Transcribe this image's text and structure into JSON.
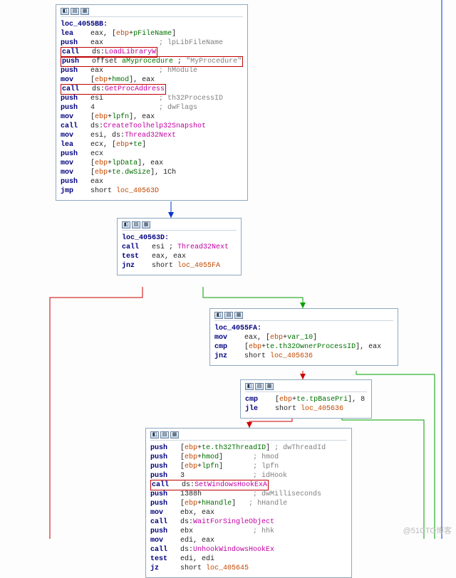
{
  "watermark": "@51CTO博客",
  "nodes": {
    "n1": {
      "label": "loc_4055BB:",
      "lines": [
        {
          "mn": "lea",
          "args": [
            {
              "t": "eax, ["
            },
            {
              "t": "ebp",
              "c": "addr"
            },
            {
              "t": "+"
            },
            {
              "t": "pFileName",
              "c": "op"
            },
            {
              "t": "]"
            }
          ]
        },
        {
          "mn": "push",
          "args": [
            {
              "t": "eax             "
            }
          ],
          "cmt": "; lpLibFileName"
        },
        {
          "hilite": true,
          "mn": "call",
          "args": [
            {
              "t": "ds:"
            },
            {
              "t": "LoadLibraryW",
              "c": "api"
            }
          ]
        },
        {
          "hilite": true,
          "mn": "push",
          "args": [
            {
              "t": "offset "
            },
            {
              "t": "aMyprocedure",
              "c": "op"
            },
            {
              "t": " ; "
            },
            {
              "t": "\"MyProcedure\"",
              "c": "cmt"
            }
          ]
        },
        {
          "mn": "push",
          "args": [
            {
              "t": "eax             "
            }
          ],
          "cmt": "; hModule"
        },
        {
          "mn": "mov",
          "args": [
            {
              "t": "["
            },
            {
              "t": "ebp",
              "c": "addr"
            },
            {
              "t": "+"
            },
            {
              "t": "hmod",
              "c": "op"
            },
            {
              "t": "], eax"
            }
          ]
        },
        {
          "hilite": true,
          "mn": "call",
          "args": [
            {
              "t": "ds:"
            },
            {
              "t": "GetProcAddress",
              "c": "api"
            }
          ]
        },
        {
          "mn": "push",
          "args": [
            {
              "t": "esi             "
            }
          ],
          "cmt": "; th32ProcessID"
        },
        {
          "mn": "push",
          "args": [
            {
              "t": "4               "
            }
          ],
          "cmt": "; dwFlags"
        },
        {
          "mn": "mov",
          "args": [
            {
              "t": "["
            },
            {
              "t": "ebp",
              "c": "addr"
            },
            {
              "t": "+"
            },
            {
              "t": "lpfn",
              "c": "op"
            },
            {
              "t": "], eax"
            }
          ]
        },
        {
          "mn": "call",
          "args": [
            {
              "t": "ds:"
            },
            {
              "t": "CreateToolhelp32Snapshot",
              "c": "api"
            }
          ]
        },
        {
          "mn": "mov",
          "args": [
            {
              "t": "esi, ds:"
            },
            {
              "t": "Thread32Next",
              "c": "api"
            }
          ]
        },
        {
          "mn": "lea",
          "args": [
            {
              "t": "ecx, ["
            },
            {
              "t": "ebp",
              "c": "addr"
            },
            {
              "t": "+"
            },
            {
              "t": "te",
              "c": "op"
            },
            {
              "t": "]"
            }
          ]
        },
        {
          "mn": "push",
          "args": [
            {
              "t": "ecx"
            }
          ]
        },
        {
          "mn": "mov",
          "args": [
            {
              "t": "["
            },
            {
              "t": "ebp",
              "c": "addr"
            },
            {
              "t": "+"
            },
            {
              "t": "lpData",
              "c": "op"
            },
            {
              "t": "], eax"
            }
          ]
        },
        {
          "mn": "mov",
          "args": [
            {
              "t": "["
            },
            {
              "t": "ebp",
              "c": "addr"
            },
            {
              "t": "+"
            },
            {
              "t": "te.dwSize",
              "c": "op"
            },
            {
              "t": "], 1Ch"
            }
          ]
        },
        {
          "mn": "push",
          "args": [
            {
              "t": "eax"
            }
          ]
        },
        {
          "mn": "jmp",
          "args": [
            {
              "t": "short "
            },
            {
              "t": "loc_40563D",
              "c": "addr"
            }
          ]
        }
      ]
    },
    "n2": {
      "label": "loc_40563D:",
      "lines": [
        {
          "mn": "call",
          "args": [
            {
              "t": "esi ; "
            },
            {
              "t": "Thread32Next",
              "c": "api"
            }
          ]
        },
        {
          "mn": "test",
          "args": [
            {
              "t": "eax, eax"
            }
          ]
        },
        {
          "mn": "jnz",
          "args": [
            {
              "t": "short "
            },
            {
              "t": "loc_4055FA",
              "c": "addr"
            }
          ]
        }
      ]
    },
    "n3": {
      "label": "loc_4055FA:",
      "lines": [
        {
          "mn": "mov",
          "args": [
            {
              "t": "eax, ["
            },
            {
              "t": "ebp",
              "c": "addr"
            },
            {
              "t": "+"
            },
            {
              "t": "var_10",
              "c": "op"
            },
            {
              "t": "]"
            }
          ]
        },
        {
          "mn": "cmp",
          "args": [
            {
              "t": "["
            },
            {
              "t": "ebp",
              "c": "addr"
            },
            {
              "t": "+"
            },
            {
              "t": "te.th32OwnerProcessID",
              "c": "op"
            },
            {
              "t": "], eax"
            }
          ]
        },
        {
          "mn": "jnz",
          "args": [
            {
              "t": "short "
            },
            {
              "t": "loc_405636",
              "c": "addr"
            }
          ]
        }
      ]
    },
    "n4": {
      "label": "",
      "lines": [
        {
          "mn": "cmp",
          "args": [
            {
              "t": "["
            },
            {
              "t": "ebp",
              "c": "addr"
            },
            {
              "t": "+"
            },
            {
              "t": "te.tpBasePri",
              "c": "op"
            },
            {
              "t": "], 8"
            }
          ]
        },
        {
          "mn": "jle",
          "args": [
            {
              "t": "short "
            },
            {
              "t": "loc_405636",
              "c": "addr"
            }
          ]
        }
      ]
    },
    "n5": {
      "label": "",
      "lines": [
        {
          "mn": "push",
          "args": [
            {
              "t": "["
            },
            {
              "t": "ebp",
              "c": "addr"
            },
            {
              "t": "+"
            },
            {
              "t": "te.th32ThreadID",
              "c": "op"
            },
            {
              "t": "] "
            }
          ],
          "cmt": "; dwThreadId"
        },
        {
          "mn": "push",
          "args": [
            {
              "t": "["
            },
            {
              "t": "ebp",
              "c": "addr"
            },
            {
              "t": "+"
            },
            {
              "t": "hmod",
              "c": "op"
            },
            {
              "t": "]       "
            }
          ],
          "cmt": "; hmod"
        },
        {
          "mn": "push",
          "args": [
            {
              "t": "["
            },
            {
              "t": "ebp",
              "c": "addr"
            },
            {
              "t": "+"
            },
            {
              "t": "lpfn",
              "c": "op"
            },
            {
              "t": "]       "
            }
          ],
          "cmt": "; lpfn"
        },
        {
          "mn": "push",
          "args": [
            {
              "t": "3                "
            }
          ],
          "cmt": "; idHook"
        },
        {
          "hilite": true,
          "mn": "call",
          "args": [
            {
              "t": "ds:"
            },
            {
              "t": "SetWindowsHookExA",
              "c": "api"
            }
          ]
        },
        {
          "mn": "push",
          "args": [
            {
              "t": "1388h            "
            }
          ],
          "cmt": "; dwMilliseconds"
        },
        {
          "mn": "push",
          "args": [
            {
              "t": "["
            },
            {
              "t": "ebp",
              "c": "addr"
            },
            {
              "t": "+"
            },
            {
              "t": "hHandle",
              "c": "op"
            },
            {
              "t": "]   "
            }
          ],
          "cmt": "; hHandle"
        },
        {
          "mn": "mov",
          "args": [
            {
              "t": "ebx, eax"
            }
          ]
        },
        {
          "mn": "call",
          "args": [
            {
              "t": "ds:"
            },
            {
              "t": "WaitForSingleObject",
              "c": "api"
            }
          ]
        },
        {
          "mn": "push",
          "args": [
            {
              "t": "ebx              "
            }
          ],
          "cmt": "; hhk"
        },
        {
          "mn": "mov",
          "args": [
            {
              "t": "edi, eax"
            }
          ]
        },
        {
          "mn": "call",
          "args": [
            {
              "t": "ds:"
            },
            {
              "t": "UnhookWindowsHookEx",
              "c": "api"
            }
          ]
        },
        {
          "mn": "test",
          "args": [
            {
              "t": "edi, edi"
            }
          ]
        },
        {
          "mn": "jz",
          "args": [
            {
              "t": "short "
            },
            {
              "t": "loc_405645",
              "c": "addr"
            }
          ]
        }
      ]
    }
  }
}
